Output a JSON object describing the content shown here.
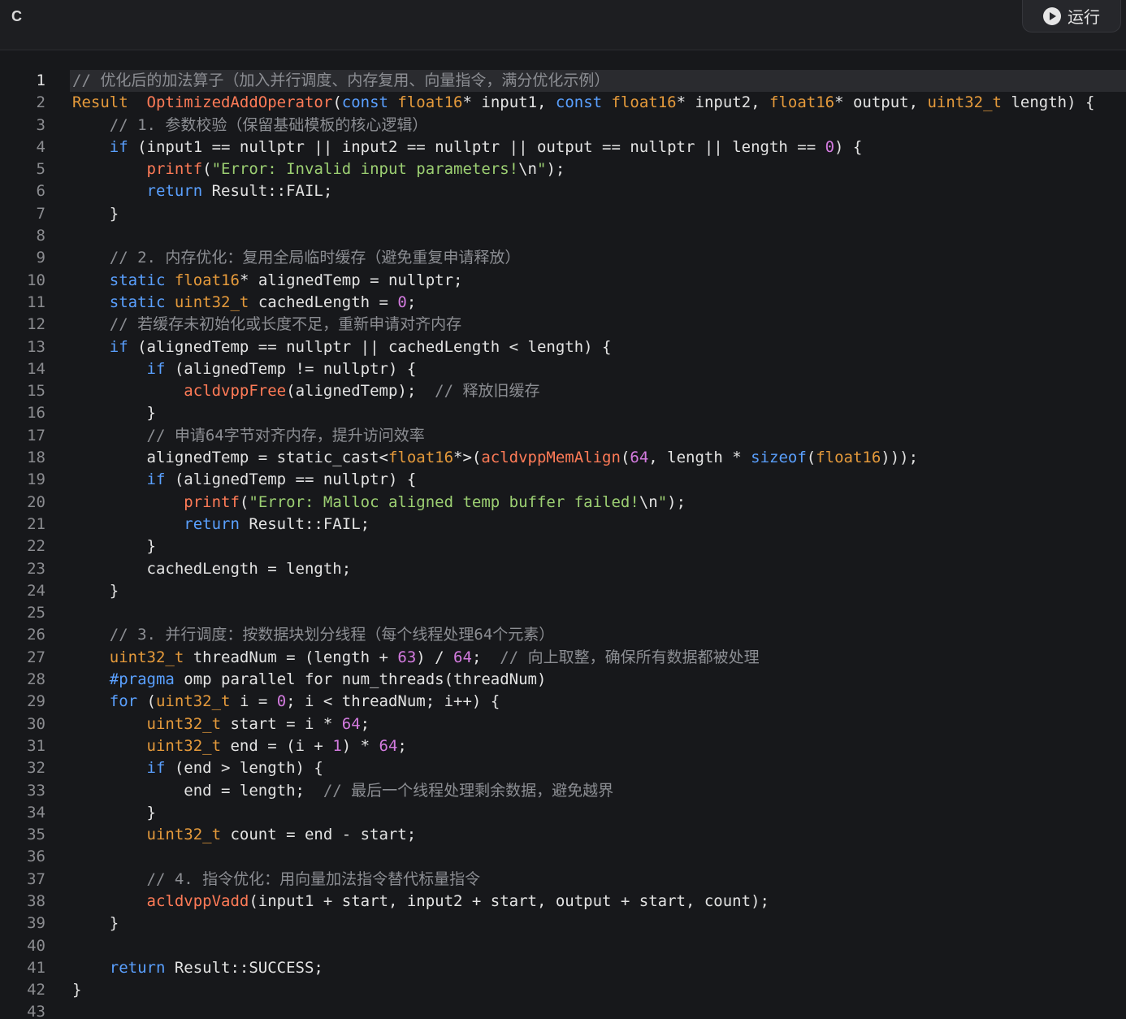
{
  "header": {
    "language": "C",
    "run_label": "运行"
  },
  "code": {
    "active_line": 1,
    "lines": [
      [
        [
          "cm",
          "// 优化后的加法算子（加入并行调度、内存复用、向量指令，满分优化示例）"
        ]
      ],
      [
        [
          "ty",
          "Result"
        ],
        [
          "",
          "  "
        ],
        [
          "fn",
          "OptimizedAddOperator"
        ],
        [
          "",
          "("
        ],
        [
          "kw",
          "const"
        ],
        [
          "",
          " "
        ],
        [
          "ty",
          "float16"
        ],
        [
          "",
          "* input1, "
        ],
        [
          "kw",
          "const"
        ],
        [
          "",
          " "
        ],
        [
          "ty",
          "float16"
        ],
        [
          "",
          "* input2, "
        ],
        [
          "ty",
          "float16"
        ],
        [
          "",
          "* output, "
        ],
        [
          "ty",
          "uint32_t"
        ],
        [
          "",
          " length) {"
        ]
      ],
      [
        [
          "",
          "    "
        ],
        [
          "cm",
          "// 1. 参数校验（保留基础模板的核心逻辑）"
        ]
      ],
      [
        [
          "",
          "    "
        ],
        [
          "kw",
          "if"
        ],
        [
          "",
          " (input1 == nullptr || input2 == nullptr || output == nullptr || length == "
        ],
        [
          "num",
          "0"
        ],
        [
          "",
          ") {"
        ]
      ],
      [
        [
          "",
          "        "
        ],
        [
          "fn",
          "printf"
        ],
        [
          "",
          "("
        ],
        [
          "str",
          "\"Error: Invalid input parameters!"
        ],
        [
          "",
          "\\n"
        ],
        [
          "str",
          "\""
        ],
        [
          "",
          ");"
        ]
      ],
      [
        [
          "",
          "        "
        ],
        [
          "kw",
          "return"
        ],
        [
          "",
          " Result::FAIL;"
        ]
      ],
      [
        [
          "",
          "    }"
        ]
      ],
      [
        [
          "",
          ""
        ]
      ],
      [
        [
          "",
          "    "
        ],
        [
          "cm",
          "// 2. 内存优化：复用全局临时缓存（避免重复申请释放）"
        ]
      ],
      [
        [
          "",
          "    "
        ],
        [
          "kw",
          "static"
        ],
        [
          "",
          " "
        ],
        [
          "ty",
          "float16"
        ],
        [
          "",
          "* alignedTemp = nullptr;"
        ]
      ],
      [
        [
          "",
          "    "
        ],
        [
          "kw",
          "static"
        ],
        [
          "",
          " "
        ],
        [
          "ty",
          "uint32_t"
        ],
        [
          "",
          " cachedLength = "
        ],
        [
          "num",
          "0"
        ],
        [
          "",
          ";"
        ]
      ],
      [
        [
          "",
          "    "
        ],
        [
          "cm",
          "// 若缓存未初始化或长度不足，重新申请对齐内存"
        ]
      ],
      [
        [
          "",
          "    "
        ],
        [
          "kw",
          "if"
        ],
        [
          "",
          " (alignedTemp == nullptr || cachedLength < length) {"
        ]
      ],
      [
        [
          "",
          "        "
        ],
        [
          "kw",
          "if"
        ],
        [
          "",
          " (alignedTemp != nullptr) {"
        ]
      ],
      [
        [
          "",
          "            "
        ],
        [
          "fn",
          "acldvppFree"
        ],
        [
          "",
          "(alignedTemp);  "
        ],
        [
          "cm",
          "// 释放旧缓存"
        ]
      ],
      [
        [
          "",
          "        }"
        ]
      ],
      [
        [
          "",
          "        "
        ],
        [
          "cm",
          "// 申请64字节对齐内存，提升访问效率"
        ]
      ],
      [
        [
          "",
          "        alignedTemp = static_cast<"
        ],
        [
          "ty",
          "float16"
        ],
        [
          "",
          "*>("
        ],
        [
          "fn",
          "acldvppMemAlign"
        ],
        [
          "",
          "("
        ],
        [
          "num",
          "64"
        ],
        [
          "",
          ", length * "
        ],
        [
          "fn2",
          "sizeof"
        ],
        [
          "",
          "("
        ],
        [
          "ty",
          "float16"
        ],
        [
          "",
          ")));"
        ]
      ],
      [
        [
          "",
          "        "
        ],
        [
          "kw",
          "if"
        ],
        [
          "",
          " (alignedTemp == nullptr) {"
        ]
      ],
      [
        [
          "",
          "            "
        ],
        [
          "fn",
          "printf"
        ],
        [
          "",
          "("
        ],
        [
          "str",
          "\"Error: Malloc aligned temp buffer failed!"
        ],
        [
          "",
          "\\n"
        ],
        [
          "str",
          "\""
        ],
        [
          "",
          ");"
        ]
      ],
      [
        [
          "",
          "            "
        ],
        [
          "kw",
          "return"
        ],
        [
          "",
          " Result::FAIL;"
        ]
      ],
      [
        [
          "",
          "        }"
        ]
      ],
      [
        [
          "",
          "        cachedLength = length;"
        ]
      ],
      [
        [
          "",
          "    }"
        ]
      ],
      [
        [
          "",
          ""
        ]
      ],
      [
        [
          "",
          "    "
        ],
        [
          "cm",
          "// 3. 并行调度：按数据块划分线程（每个线程处理64个元素）"
        ]
      ],
      [
        [
          "",
          "    "
        ],
        [
          "ty",
          "uint32_t"
        ],
        [
          "",
          " threadNum = (length + "
        ],
        [
          "num",
          "63"
        ],
        [
          "",
          ") / "
        ],
        [
          "num",
          "64"
        ],
        [
          "",
          ";  "
        ],
        [
          "cm",
          "// 向上取整，确保所有数据都被处理"
        ]
      ],
      [
        [
          "",
          "    "
        ],
        [
          "pp",
          "#pragma"
        ],
        [
          "",
          " omp parallel for num_threads(threadNum)"
        ]
      ],
      [
        [
          "",
          "    "
        ],
        [
          "kw",
          "for"
        ],
        [
          "",
          " ("
        ],
        [
          "ty",
          "uint32_t"
        ],
        [
          "",
          " i = "
        ],
        [
          "num",
          "0"
        ],
        [
          "",
          "; i < threadNum; i++) {"
        ]
      ],
      [
        [
          "",
          "        "
        ],
        [
          "ty",
          "uint32_t"
        ],
        [
          "",
          " start = i * "
        ],
        [
          "num",
          "64"
        ],
        [
          "",
          ";"
        ]
      ],
      [
        [
          "",
          "        "
        ],
        [
          "ty",
          "uint32_t"
        ],
        [
          "",
          " end = (i + "
        ],
        [
          "num",
          "1"
        ],
        [
          "",
          ") * "
        ],
        [
          "num",
          "64"
        ],
        [
          "",
          ";"
        ]
      ],
      [
        [
          "",
          "        "
        ],
        [
          "kw",
          "if"
        ],
        [
          "",
          " (end > length) {"
        ]
      ],
      [
        [
          "",
          "            end = length;  "
        ],
        [
          "cm",
          "// 最后一个线程处理剩余数据，避免越界"
        ]
      ],
      [
        [
          "",
          "        }"
        ]
      ],
      [
        [
          "",
          "        "
        ],
        [
          "ty",
          "uint32_t"
        ],
        [
          "",
          " count = end - start;"
        ]
      ],
      [
        [
          "",
          ""
        ]
      ],
      [
        [
          "",
          "        "
        ],
        [
          "cm",
          "// 4. 指令优化：用向量加法指令替代标量指令"
        ]
      ],
      [
        [
          "",
          "        "
        ],
        [
          "fn",
          "acldvppVadd"
        ],
        [
          "",
          "(input1 + start, input2 + start, output + start, count);"
        ]
      ],
      [
        [
          "",
          "    }"
        ]
      ],
      [
        [
          "",
          ""
        ]
      ],
      [
        [
          "",
          "    "
        ],
        [
          "kw",
          "return"
        ],
        [
          "",
          " Result::SUCCESS;"
        ]
      ],
      [
        [
          "",
          "}"
        ]
      ],
      [
        [
          "",
          ""
        ]
      ]
    ]
  }
}
